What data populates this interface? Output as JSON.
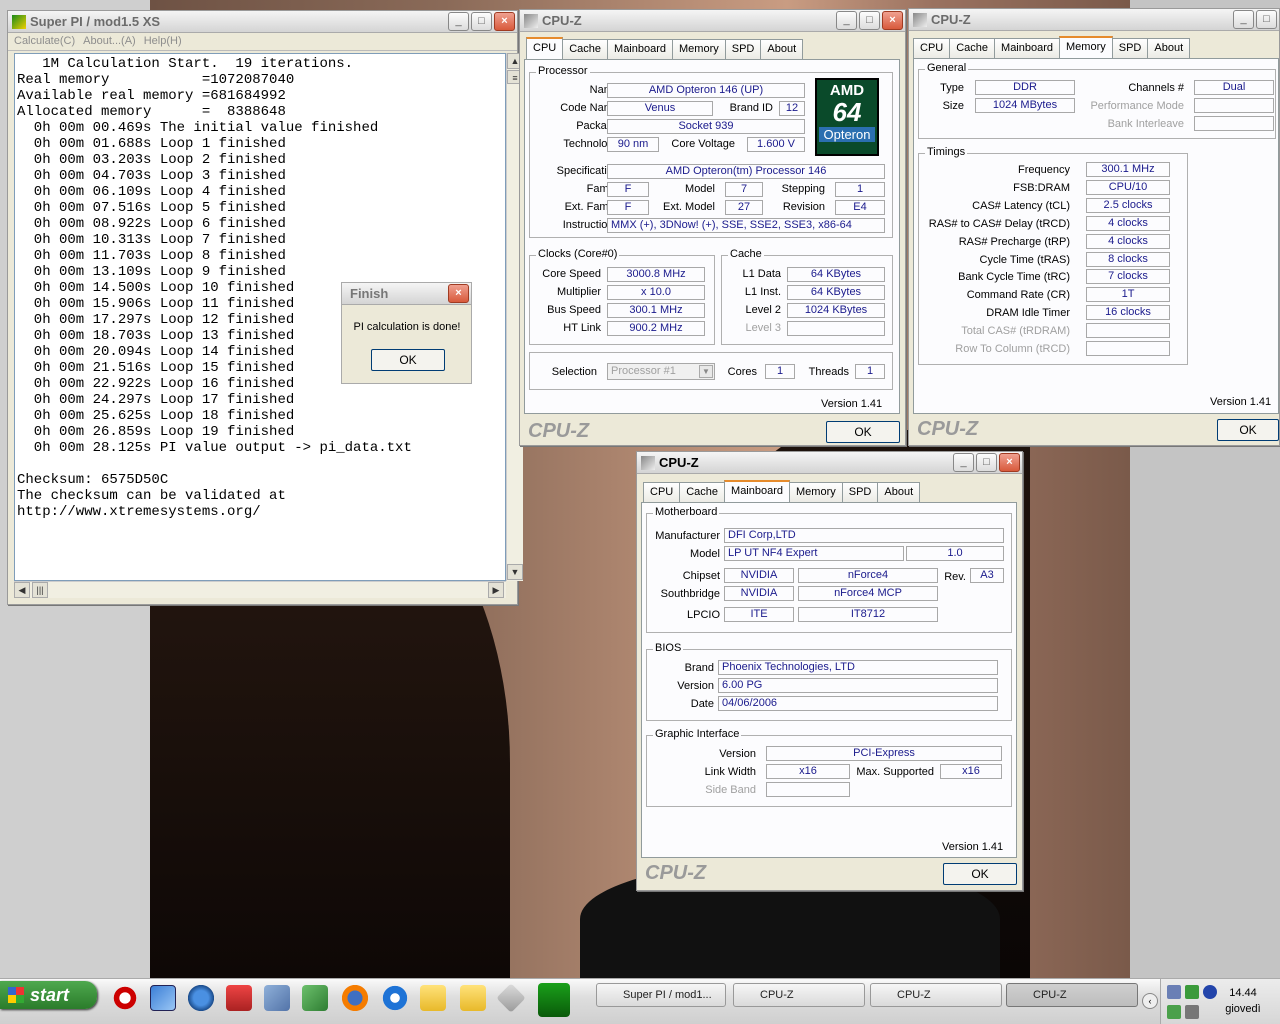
{
  "superpi": {
    "title": "Super PI / mod1.5 XS",
    "menu": [
      "Calculate(C)",
      "About...(A)",
      "Help(H)"
    ],
    "output_lines": [
      "   1M Calculation Start.  19 iterations.",
      "Real memory           =1072087040",
      "Available real memory =681684992",
      "Allocated memory      =  8388648",
      "  0h 00m 00.469s The initial value finished",
      "  0h 00m 01.688s Loop 1 finished",
      "  0h 00m 03.203s Loop 2 finished",
      "  0h 00m 04.703s Loop 3 finished",
      "  0h 00m 06.109s Loop 4 finished",
      "  0h 00m 07.516s Loop 5 finished",
      "  0h 00m 08.922s Loop 6 finished",
      "  0h 00m 10.313s Loop 7 finished",
      "  0h 00m 11.703s Loop 8 finished",
      "  0h 00m 13.109s Loop 9 finished",
      "  0h 00m 14.500s Loop 10 finished",
      "  0h 00m 15.906s Loop 11 finished",
      "  0h 00m 17.297s Loop 12 finished",
      "  0h 00m 18.703s Loop 13 finished",
      "  0h 00m 20.094s Loop 14 finished",
      "  0h 00m 21.516s Loop 15 finished",
      "  0h 00m 22.922s Loop 16 finished",
      "  0h 00m 24.297s Loop 17 finished",
      "  0h 00m 25.625s Loop 18 finished",
      "  0h 00m 26.859s Loop 19 finished",
      "  0h 00m 28.125s PI value output -> pi_data.txt",
      "",
      "Checksum: 6575D50C",
      "The checksum can be validated at",
      "http://www.xtremesystems.org/"
    ]
  },
  "finish_dialog": {
    "title": "Finish",
    "message": "PI calculation is done!",
    "ok": "OK"
  },
  "cpuz_common": {
    "title": "CPU-Z",
    "tabs": [
      "CPU",
      "Cache",
      "Mainboard",
      "Memory",
      "SPD",
      "About"
    ],
    "brand": "CPU-Z",
    "version": "Version 1.41",
    "ok": "OK"
  },
  "cpu": {
    "processor_group": "Processor",
    "name_label": "Name",
    "name": "AMD Opteron 146 (UP)",
    "codename_label": "Code Name",
    "codename": "Venus",
    "brandid_label": "Brand ID",
    "brandid": "12",
    "package_label": "Package",
    "package": "Socket 939",
    "technology_label": "Technology",
    "technology": "90 nm",
    "corevoltage_label": "Core Voltage",
    "corevoltage": "1.600 V",
    "spec_label": "Specification",
    "spec": "AMD Opteron(tm) Processor 146",
    "family_label": "Family",
    "family": "F",
    "model_label": "Model",
    "model": "7",
    "stepping_label": "Stepping",
    "stepping": "1",
    "extfamily_label": "Ext. Family",
    "extfamily": "F",
    "extmodel_label": "Ext. Model",
    "extmodel": "27",
    "revision_label": "Revision",
    "revision": "E4",
    "instructions_label": "Instructions",
    "instructions": "MMX (+), 3DNow! (+), SSE, SSE2, SSE3, x86-64",
    "logo": {
      "top": "AMD",
      "mid": "64",
      "bottom": "Opteron"
    },
    "clocks_group": "Clocks (Core#0)",
    "corespeed_label": "Core Speed",
    "corespeed": "3000.8 MHz",
    "multiplier_label": "Multiplier",
    "multiplier": "x 10.0",
    "busspeed_label": "Bus Speed",
    "busspeed": "300.1 MHz",
    "htlink_label": "HT Link",
    "htlink": "900.2 MHz",
    "cache_group": "Cache",
    "l1data_label": "L1 Data",
    "l1data": "64 KBytes",
    "l1inst_label": "L1 Inst.",
    "l1inst": "64 KBytes",
    "level2_label": "Level 2",
    "level2": "1024 KBytes",
    "level3_label": "Level 3",
    "level3": "",
    "selection_label": "Selection",
    "selection": "Processor #1",
    "cores_label": "Cores",
    "cores": "1",
    "threads_label": "Threads",
    "threads": "1"
  },
  "memory": {
    "general_group": "General",
    "type_label": "Type",
    "type": "DDR",
    "size_label": "Size",
    "size": "1024 MBytes",
    "channels_label": "Channels #",
    "channels": "Dual",
    "perfmode_label": "Performance Mode",
    "perfmode": "",
    "bankinterleave_label": "Bank Interleave",
    "bankinterleave": "",
    "timings_group": "Timings",
    "frequency_label": "Frequency",
    "frequency": "300.1 MHz",
    "fsbdram_label": "FSB:DRAM",
    "fsbdram": "CPU/10",
    "cas_label": "CAS# Latency (tCL)",
    "cas": "2.5 clocks",
    "rcd_label": "RAS# to CAS# Delay (tRCD)",
    "rcd": "4 clocks",
    "rp_label": "RAS# Precharge (tRP)",
    "rp": "4 clocks",
    "ras_label": "Cycle Time (tRAS)",
    "ras": "8 clocks",
    "rc_label": "Bank Cycle Time (tRC)",
    "rc": "7 clocks",
    "cr_label": "Command Rate (CR)",
    "cr": "1T",
    "idle_label": "DRAM Idle Timer",
    "idle": "16 clocks",
    "totalcas_label": "Total CAS# (tRDRAM)",
    "totalcas": "",
    "rowcol_label": "Row To Column (tRCD)",
    "rowcol": ""
  },
  "mainboard": {
    "mb_group": "Motherboard",
    "manufacturer_label": "Manufacturer",
    "manufacturer": "DFI Corp,LTD",
    "model_label": "Model",
    "model": "LP UT NF4 Expert",
    "model_rev": "1.0",
    "chipset_label": "Chipset",
    "chipset_vendor": "NVIDIA",
    "chipset": "nForce4",
    "rev_label": "Rev.",
    "rev": "A3",
    "southbridge_label": "Southbridge",
    "sb_vendor": "NVIDIA",
    "sb": "nForce4 MCP",
    "lpcio_label": "LPCIO",
    "lpcio_vendor": "ITE",
    "lpcio": "IT8712",
    "bios_group": "BIOS",
    "brand_label": "Brand",
    "brand": "Phoenix Technologies, LTD",
    "version_label": "Version",
    "version": "6.00 PG",
    "date_label": "Date",
    "date": "04/06/2006",
    "gi_group": "Graphic Interface",
    "giversion_label": "Version",
    "giversion": "PCI-Express",
    "linkwidth_label": "Link Width",
    "linkwidth": "x16",
    "maxsupported_label": "Max. Supported",
    "maxsupported": "x16",
    "sideband_label": "Side Band",
    "sideband": ""
  },
  "taskbar": {
    "start": "start",
    "items": [
      "Super PI / mod1...",
      "CPU-Z",
      "CPU-Z",
      "CPU-Z"
    ],
    "clock_time": "14.44",
    "clock_day": "giovedì"
  }
}
